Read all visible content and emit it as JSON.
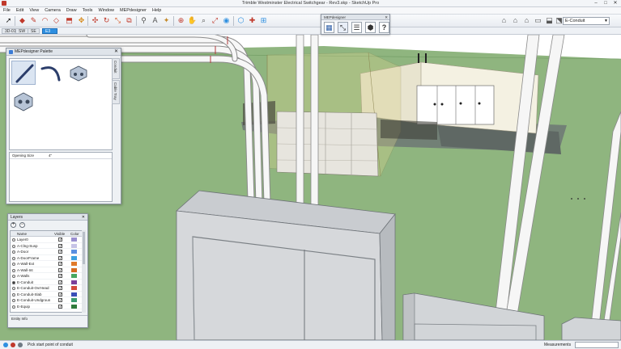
{
  "window": {
    "title": "Trimble Westminster Electrical Switchgear - Rev3.skp - SketchUp Pro",
    "controls": [
      "–",
      "□",
      "✕"
    ]
  },
  "menu": [
    "File",
    "Edit",
    "View",
    "Camera",
    "Draw",
    "Tools",
    "Window",
    "MEPdesigner",
    "Help"
  ],
  "toolbar": {
    "left_icons": [
      "select-icon",
      "eraser-icon",
      "pencil-icon",
      "arc-icon",
      "shape-icon",
      "push-pull-icon",
      "move-icon",
      "rotate-icon",
      "scale-icon",
      "offset-icon",
      "tape-icon",
      "text-icon",
      "paint-icon",
      "orbit-icon",
      "pan-icon",
      "zoom-icon",
      "zoom-extents-icon",
      "previous-view-icon",
      "next-view-icon",
      "warehouse-icon",
      "extension-icon",
      "share-icon"
    ],
    "right_icons": [
      "iso-view-icon",
      "top-view-icon",
      "front-view-icon",
      "right-view-icon",
      "back-view-icon",
      "left-view-icon"
    ],
    "layer_value": "E-Conduit"
  },
  "scenes": [
    {
      "label": "3D-01",
      "active": false
    },
    {
      "label": "SW",
      "active": false
    },
    {
      "label": "SE",
      "active": false
    },
    {
      "label": "E3",
      "active": true
    }
  ],
  "mep_toolbar": {
    "title": "MEPdesigner",
    "buttons": [
      "mep-palette-icon",
      "conduit-draw-icon",
      "conduit-list-icon",
      "box-3d-icon",
      "help-icon"
    ],
    "help_glyph": "?"
  },
  "palette": {
    "title": "MEPdesigner Palette",
    "side_tabs": [
      "Conduit",
      "Cable Tray"
    ],
    "items": [
      "straight-conduit-icon",
      "elbow-conduit-icon",
      "junction-box-icon",
      "pull-box-icon"
    ],
    "properties": [
      {
        "label": "Opening Size",
        "value": "4\""
      }
    ]
  },
  "layers": {
    "title": "Layers",
    "columns": [
      "Name",
      "Visible",
      "Color"
    ],
    "rows": [
      {
        "name": "Layer0",
        "active": false,
        "visible": true,
        "color": "#9a8fd0"
      },
      {
        "name": "A-Clng-Susp",
        "active": false,
        "visible": true,
        "color": "#c6c3e6"
      },
      {
        "name": "A-Door",
        "active": false,
        "visible": true,
        "color": "#5a8fe0"
      },
      {
        "name": "A-DoorFrame",
        "active": false,
        "visible": true,
        "color": "#3ca0e0"
      },
      {
        "name": "A-Wall-Ext",
        "active": false,
        "visible": true,
        "color": "#e07a2a"
      },
      {
        "name": "A-Wall-Int",
        "active": false,
        "visible": true,
        "color": "#d46b1f"
      },
      {
        "name": "A-Walls",
        "active": false,
        "visible": true,
        "color": "#48a860"
      },
      {
        "name": "E-Conduit",
        "active": true,
        "visible": true,
        "color": "#7a3f9a"
      },
      {
        "name": "E-Conduit-OvrHead",
        "active": false,
        "visible": true,
        "color": "#d24a3c"
      },
      {
        "name": "E-Conduit-Slab",
        "active": false,
        "visible": true,
        "color": "#3a4fb8"
      },
      {
        "name": "E-Conduit-Undgroun",
        "active": false,
        "visible": true,
        "color": "#3a9a6e"
      },
      {
        "name": "E-Equip",
        "active": false,
        "visible": true,
        "color": "#2f7a3c"
      }
    ],
    "entity_info": "Entity Info"
  },
  "status": {
    "message": "Pick start point of conduit",
    "measurements_label": "Measurements",
    "measurements_value": ""
  },
  "colors": {
    "ground": "#8fb57f",
    "sky": "#ffffff",
    "conduit": "#f4f4f4",
    "panel": "#d4d7da",
    "accent": "#2e8fe0"
  }
}
